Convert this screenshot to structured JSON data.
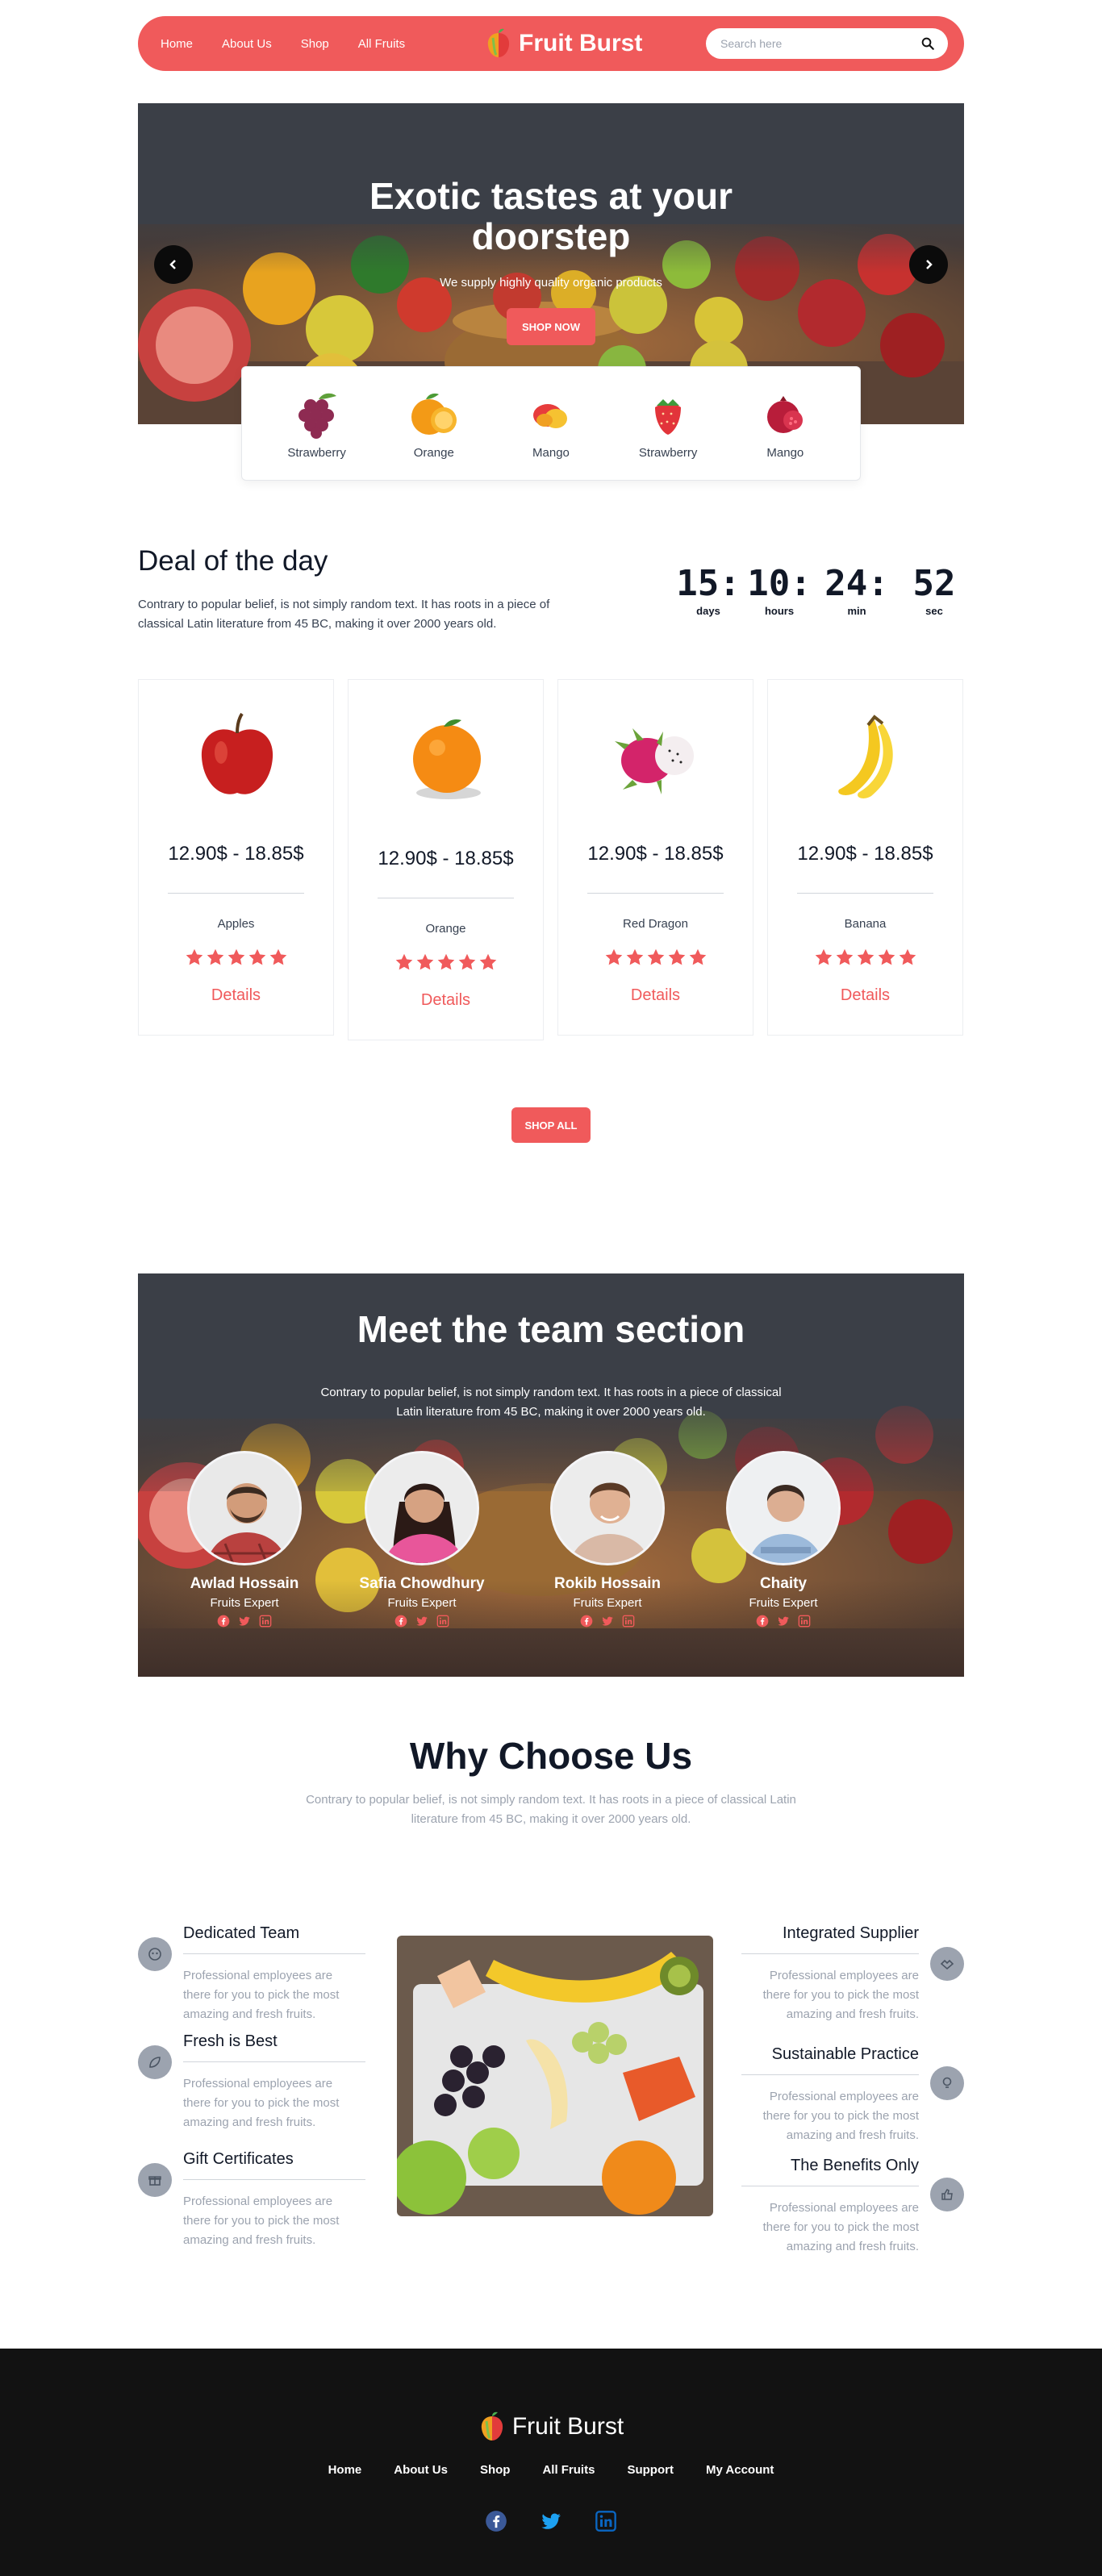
{
  "nav": {
    "links": [
      "Home",
      "About Us",
      "Shop",
      "All Fruits"
    ],
    "brand": "Fruit Burst",
    "search_placeholder": "Search here"
  },
  "hero": {
    "title": "Exotic tastes at your doorstep",
    "subtitle": "We supply highly quality organic products",
    "button": "SHOP NOW"
  },
  "categories": [
    "Strawberry",
    "Orange",
    "Mango",
    "Strawberry",
    "Mango"
  ],
  "deal": {
    "title": "Deal of the day",
    "description": "Contrary to popular belief, is not simply random text. It has roots in a piece of classical Latin literature from 45 BC, making it over 2000 years old.",
    "countdown": [
      {
        "value": "15:",
        "label": "days"
      },
      {
        "value": "10:",
        "label": "hours"
      },
      {
        "value": "24:",
        "label": "min"
      },
      {
        "value": "52",
        "label": "sec"
      }
    ]
  },
  "products": [
    {
      "price": "12.90$ - 18.85$",
      "name": "Apples",
      "rating": 5,
      "link": "Details"
    },
    {
      "price": "12.90$ - 18.85$",
      "name": "Orange",
      "rating": 5,
      "link": "Details"
    },
    {
      "price": "12.90$ - 18.85$",
      "name": "Red Dragon",
      "rating": 5,
      "link": "Details"
    },
    {
      "price": "12.90$ - 18.85$",
      "name": "Banana",
      "rating": 5,
      "link": "Details"
    }
  ],
  "shop_all": "SHOP ALL",
  "team": {
    "title": "Meet the team section",
    "description": "Contrary to popular belief, is not simply random text. It has roots in a piece of classical Latin literature from 45 BC, making it over 2000 years old.",
    "members": [
      {
        "name": "Awlad Hossain",
        "role": "Fruits Expert"
      },
      {
        "name": "Safia Chowdhury",
        "role": "Fruits Expert"
      },
      {
        "name": "Rokib Hossain",
        "role": "Fruits Expert"
      },
      {
        "name": "Chaity",
        "role": "Fruits Expert"
      }
    ]
  },
  "why": {
    "title": "Why Choose Us",
    "description": "Contrary to popular belief, is not simply random text. It has roots in a piece of classical Latin literature from 45 BC, making it over 2000 years old.",
    "features_left": [
      {
        "title": "Dedicated Team",
        "text": "Professional employees are there for you to pick the most amazing and fresh fruits."
      },
      {
        "title": "Fresh is Best",
        "text": "Professional employees are there for you to pick the most amazing and fresh fruits."
      },
      {
        "title": "Gift Certificates",
        "text": "Professional employees are there for you to pick the most amazing and fresh fruits."
      }
    ],
    "features_right": [
      {
        "title": "Integrated Supplier",
        "text": "Professional employees are there for you to pick the most amazing and fresh fruits."
      },
      {
        "title": "Sustainable Practice",
        "text": "Professional employees are there for you to pick the most amazing and fresh fruits."
      },
      {
        "title": "The Benefits Only",
        "text": "Professional employees are there for you to pick the most amazing and fresh fruits."
      }
    ]
  },
  "footer": {
    "brand": "Fruit Burst",
    "links": [
      "Home",
      "About Us",
      "Shop",
      "All Fruits",
      "Support",
      "My Account"
    ],
    "social": [
      "facebook-icon",
      "twitter-icon",
      "linkedin-icon"
    ]
  },
  "colors": {
    "accent": "#f05a5b",
    "dark": "#3b3f47",
    "footer": "#121212",
    "muted": "#9ca3af"
  }
}
